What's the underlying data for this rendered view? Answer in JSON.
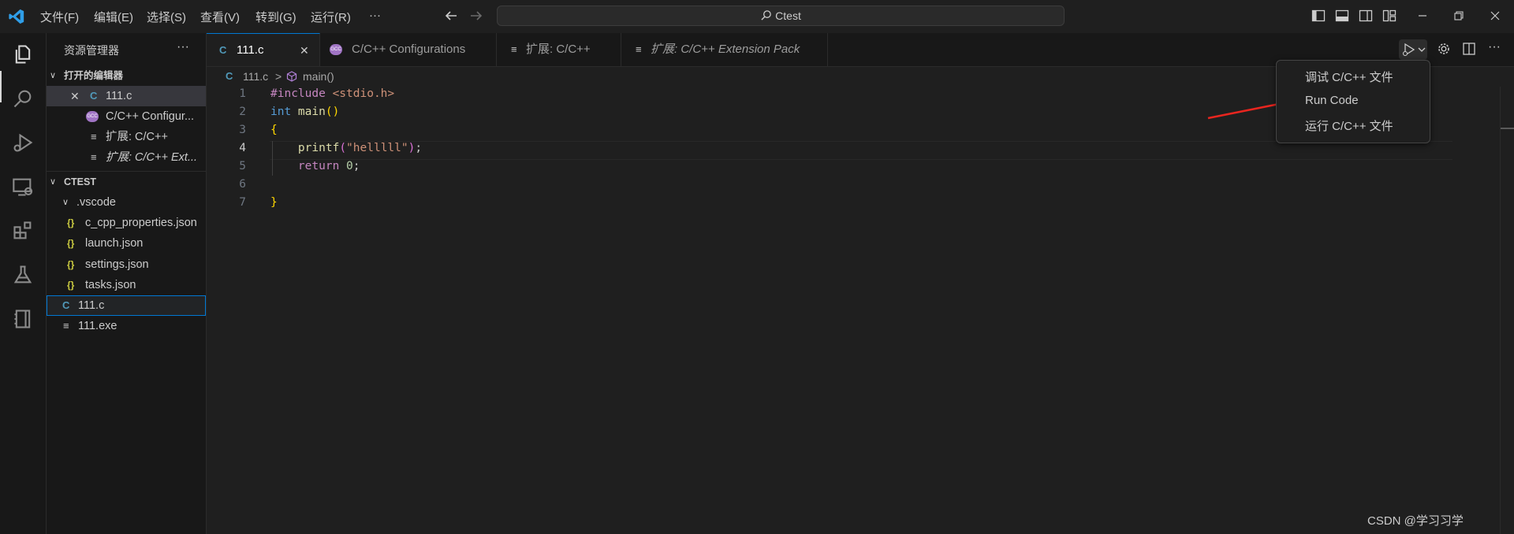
{
  "titlebar": {
    "menus": [
      "文件(F)",
      "编辑(E)",
      "选择(S)",
      "查看(V)",
      "转到(G)",
      "运行(R)",
      "···"
    ],
    "search_text": "Ctest"
  },
  "sidebar": {
    "title": "资源管理器",
    "more": "···",
    "open_editors_header": "打开的编辑器",
    "open_editors": [
      {
        "glyph": "C",
        "label": "111.c"
      },
      {
        "glyph": "GCC",
        "label": "C/C++ Configur..."
      },
      {
        "glyph": "≡",
        "label": "扩展: C/C++"
      },
      {
        "glyph": "≡",
        "label": "扩展: C/C++ Ext..."
      }
    ],
    "project_header": "CTEST",
    "files": [
      {
        "glyph": "",
        "label": ".vscode"
      },
      {
        "glyph": "{}",
        "label": "c_cpp_properties.json"
      },
      {
        "glyph": "{}",
        "label": "launch.json"
      },
      {
        "glyph": "{}",
        "label": "settings.json"
      },
      {
        "glyph": "{}",
        "label": "tasks.json"
      },
      {
        "glyph": "C",
        "label": "111.c"
      },
      {
        "glyph": "≡",
        "label": "111.exe"
      }
    ]
  },
  "tabs": [
    {
      "glyph": "C",
      "label": "111.c",
      "close": "✕"
    },
    {
      "glyph": "GCC",
      "label": "C/C++ Configurations"
    },
    {
      "glyph": "≡",
      "label": "扩展: C/C++"
    },
    {
      "glyph": "≡",
      "label": "扩展: C/C++ Extension Pack"
    }
  ],
  "breadcrumb": {
    "file": "111.c",
    "sep": ">",
    "symbol": "main()"
  },
  "editor": {
    "line_numbers": [
      "1",
      "2",
      "3",
      "4",
      "5",
      "6",
      "7"
    ],
    "code": {
      "l1_directive": "#include",
      "l1_header": " <stdio.h>",
      "l2_type": "int",
      "l2_func": " main",
      "l2_parens": "()",
      "l3_brace": "{",
      "l4_indent": "    ",
      "l4_func": "printf",
      "l4_open": "(",
      "l4_str": "\"helllll\"",
      "l4_close": ")",
      "l4_semi": ";",
      "l5_indent": "    ",
      "l5_kw": "return",
      "l5_num": " 0",
      "l5_semi": ";",
      "l7_brace": "}"
    }
  },
  "run_menu": {
    "items": [
      "调试 C/C++ 文件",
      "Run Code",
      "运行 C/C++ 文件"
    ]
  },
  "colors": {
    "accent": "#0078d4",
    "arrow": "#e8251f"
  },
  "watermark": "CSDN @学习习学"
}
